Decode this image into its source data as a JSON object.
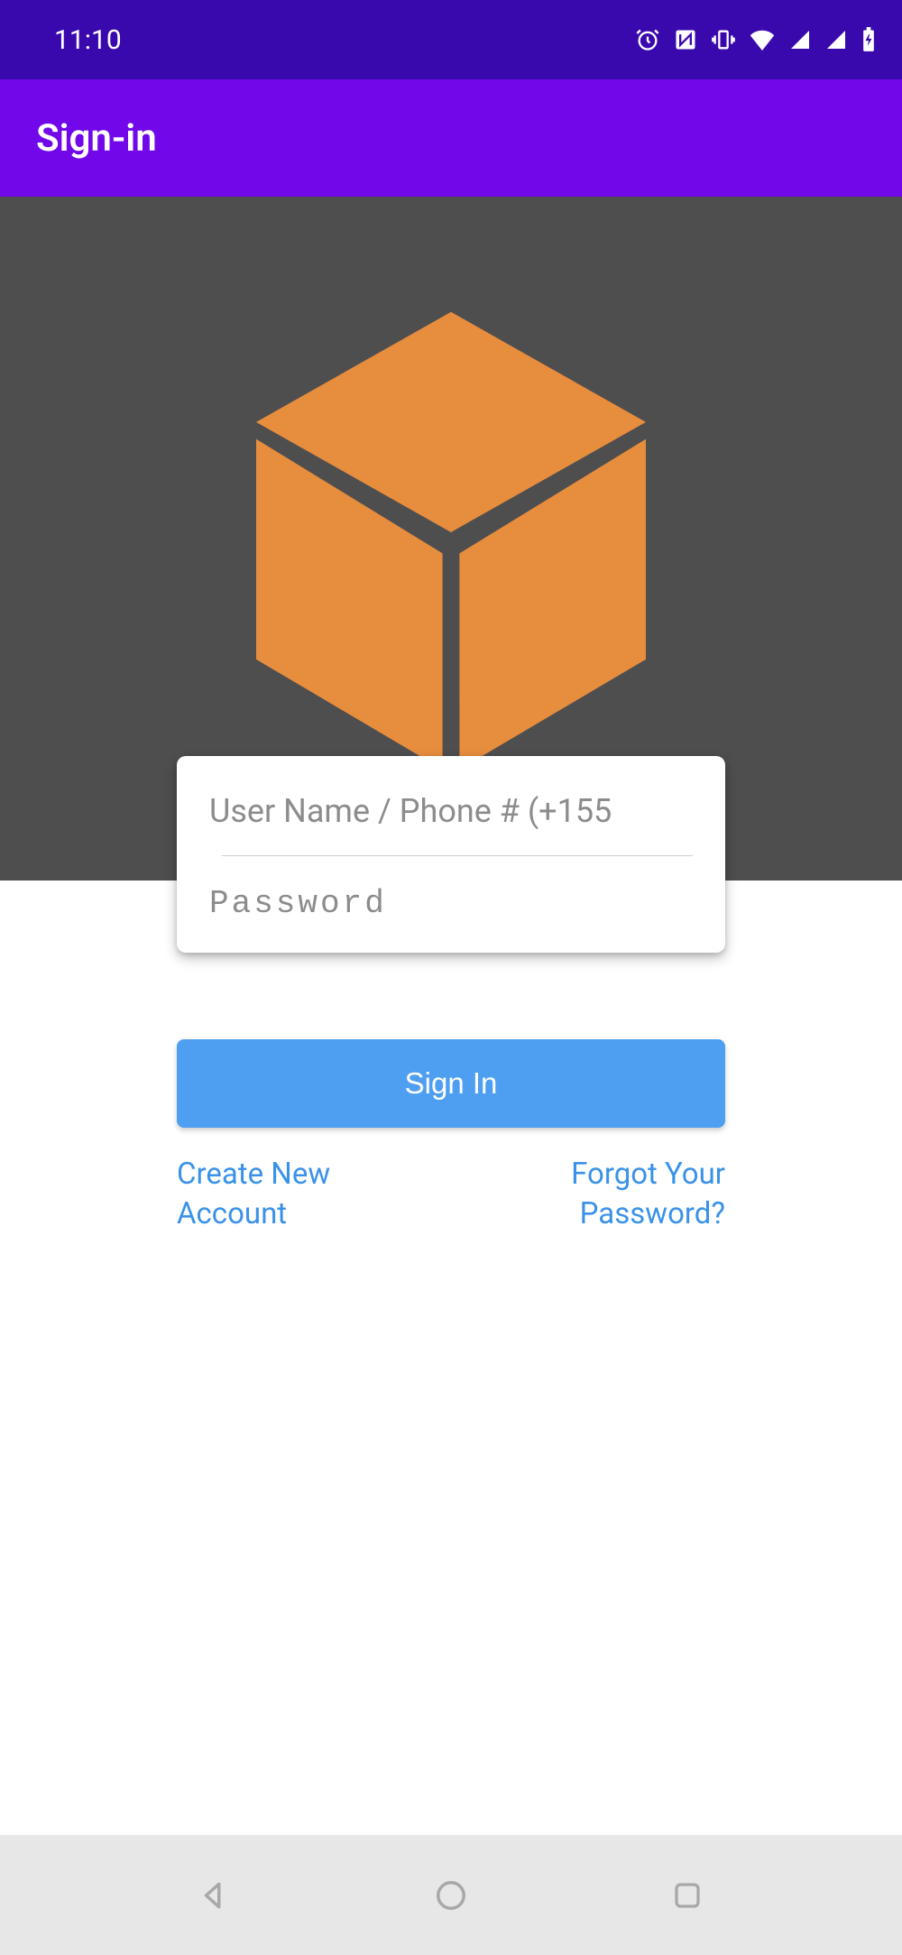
{
  "status": {
    "time": "11:10"
  },
  "appbar": {
    "title": "Sign-in"
  },
  "form": {
    "username_placeholder": "User Name / Phone # (+155",
    "password_placeholder": "Password",
    "signin_label": "Sign In"
  },
  "links": {
    "create": "Create New Account",
    "forgot": "Forgot Your Password?"
  },
  "colors": {
    "status_bar": "#3a09ae",
    "app_bar": "#7208ea",
    "hero_bg": "#4e4e4e",
    "cube": "#e78d3e",
    "primary_btn": "#4e9ff1",
    "link": "#3a92e8"
  }
}
